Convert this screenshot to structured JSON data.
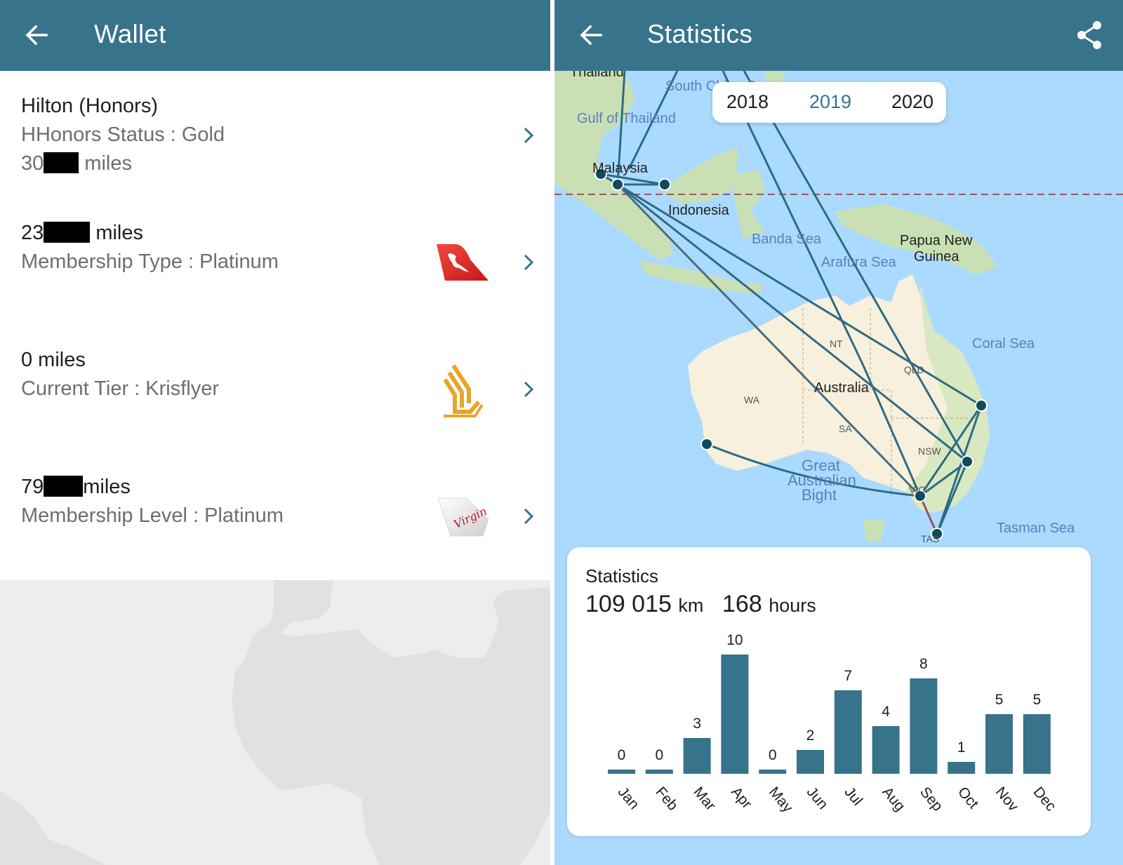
{
  "wallet": {
    "title": "Wallet",
    "items": [
      {
        "name": "Hilton (Honors)",
        "status": "HHonors Status : Gold",
        "miles_prefix": "30",
        "miles_suffix": "miles",
        "logo": "none"
      },
      {
        "miles_prefix": "23",
        "miles_suffix": "miles",
        "status": "Membership Type : Platinum",
        "logo": "qantas-logo"
      },
      {
        "miles": "0 miles",
        "status": "Current Tier : Krisflyer",
        "logo": "singapore-airlines-logo"
      },
      {
        "miles_prefix": "79",
        "miles_suffix": "miles",
        "status": "Membership Level : Platinum",
        "logo": "virgin-australia-logo",
        "logo_text": "Virgin"
      }
    ]
  },
  "statistics": {
    "title": "Statistics",
    "years": [
      "2018",
      "2019",
      "2020"
    ],
    "selected_year": "2019",
    "card_label": "Statistics",
    "distance_value": "109 015",
    "distance_unit": "km",
    "hours_value": "168",
    "hours_unit": "hours",
    "accent_color": "#37738b",
    "map_labels": {
      "thailand": "Thailand",
      "south_china_sea": "South China Sea",
      "gulf_of_thailand": "Gulf of Thailand",
      "malaysia": "Malaysia",
      "indonesia": "Indonesia",
      "banda_sea": "Banda Sea",
      "arafura_sea": "Arafura Sea",
      "png_line1": "Papua New",
      "png_line2": "Guinea",
      "coral_sea": "Coral Sea",
      "nt": "NT",
      "qld": "QLD",
      "australia": "Australia",
      "wa": "WA",
      "sa": "SA",
      "nsw": "NSW",
      "vic": "VIC",
      "tas": "TAS",
      "gab_line1": "Great",
      "gab_line2": "Australian",
      "gab_line3": "Bight",
      "tasman_sea": "Tasman Sea"
    }
  },
  "chart_data": {
    "type": "bar",
    "title": "Statistics",
    "categories": [
      "Jan",
      "Feb",
      "Mar",
      "Apr",
      "May",
      "Jun",
      "Jul",
      "Aug",
      "Sep",
      "Oct",
      "Nov",
      "Dec"
    ],
    "values": [
      0,
      0,
      3,
      10,
      0,
      2,
      7,
      4,
      8,
      1,
      5,
      5
    ],
    "xlabel": "",
    "ylabel": "",
    "ylim": [
      0,
      10
    ],
    "grid": false,
    "data_labels": true,
    "bar_color": "#37738b"
  }
}
